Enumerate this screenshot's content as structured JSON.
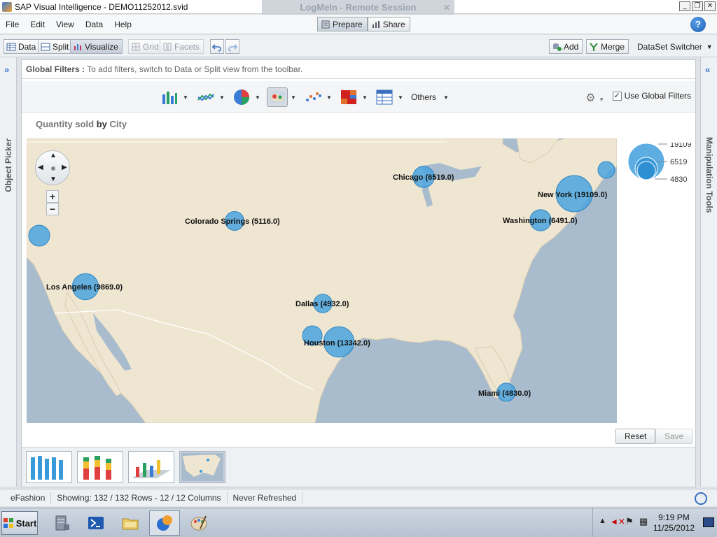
{
  "window": {
    "title": "SAP Visual Intelligence - DEMO11252012.svid",
    "overlay_title": "LogMeIn - Remote Session"
  },
  "menu": {
    "items": [
      "File",
      "Edit",
      "View",
      "Data",
      "Help"
    ],
    "prepare_label": "Prepare",
    "share_label": "Share"
  },
  "toolbar": {
    "data_label": "Data",
    "split_label": "Split",
    "visualize_label": "Visualize",
    "grid_label": "Grid",
    "facets_label": "Facets",
    "add_label": "Add",
    "merge_label": "Merge",
    "dataset_switcher_label": "DataSet Switcher"
  },
  "rails": {
    "left_label": "Object Picker",
    "right_label": "Manipulation Tools"
  },
  "global_filters": {
    "label": "Global Filters :",
    "hint": "To add filters, switch to Data or Split view from the toolbar."
  },
  "chart_toolbar": {
    "others_label": "Others",
    "use_global_filters_label": "Use Global Filters",
    "use_global_filters_checked": true
  },
  "chart": {
    "title_measure": "Quantity sold",
    "title_by": "by",
    "title_dimension": "City",
    "legend_values": [
      "19109",
      "6519",
      "4830"
    ]
  },
  "chart_data": {
    "type": "scatter",
    "title": "Quantity sold by City",
    "points": [
      {
        "label": "Chicago (6519.0)",
        "city": "Chicago",
        "value": 6519.0
      },
      {
        "label": "New York (19109.0)",
        "city": "New York",
        "value": 19109.0
      },
      {
        "label": "Washington (6491.0)",
        "city": "Washington",
        "value": 6491.0
      },
      {
        "label": "Colorado Springs (5116.0)",
        "city": "Colorado Springs",
        "value": 5116.0
      },
      {
        "label": "Los Angeles (9869.0)",
        "city": "Los Angeles",
        "value": 9869.0
      },
      {
        "label": "Dallas (4932.0)",
        "city": "Dallas",
        "value": 4932.0
      },
      {
        "label": "Houston (13342.0)",
        "city": "Houston",
        "value": 13342.0
      },
      {
        "label": "Miami (4830.0)",
        "city": "Miami",
        "value": 4830.0
      }
    ],
    "legend": [
      "19109",
      "6519",
      "4830"
    ]
  },
  "actions": {
    "reset_label": "Reset",
    "save_label": "Save"
  },
  "status": {
    "universe": "eFashion",
    "showing": "Showing: 132 / 132 Rows - 12 / 12 Columns",
    "refresh": "Never Refreshed"
  },
  "taskbar": {
    "start_label": "Start",
    "time": "9:19 PM",
    "date": "11/25/2012"
  }
}
